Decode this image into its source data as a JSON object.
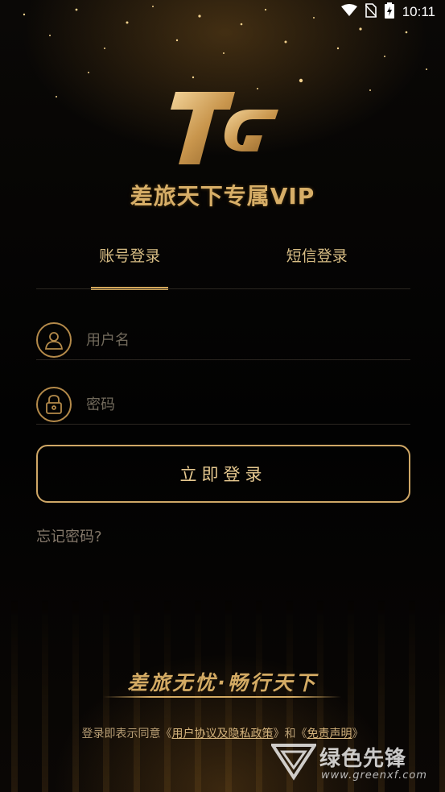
{
  "status_bar": {
    "time": "10:11",
    "icons": [
      "wifi-icon",
      "no-sim-icon",
      "battery-charging-icon"
    ]
  },
  "brand": {
    "logo_text": "TG",
    "tagline": "差旅天下专属VIP"
  },
  "tabs": [
    {
      "label": "账号登录",
      "active": true
    },
    {
      "label": "短信登录",
      "active": false
    }
  ],
  "form": {
    "username_placeholder": "用户名",
    "password_placeholder": "密码",
    "username_value": "",
    "password_value": "",
    "submit_label": "立即登录",
    "forgot_label": "忘记密码?"
  },
  "footer": {
    "slogan": "差旅无忧·畅行天下",
    "agreement_prefix": "登录即表示同意《",
    "user_agreement_link": "用户协议及隐私政策",
    "agreement_middle": "》和《",
    "disclaimer_link": "免责声明",
    "agreement_suffix": "》"
  },
  "watermark": {
    "name": "绿色先锋",
    "url": "www.greenxf.com"
  },
  "colors": {
    "gold": "#d4a85b",
    "background": "#050403"
  }
}
